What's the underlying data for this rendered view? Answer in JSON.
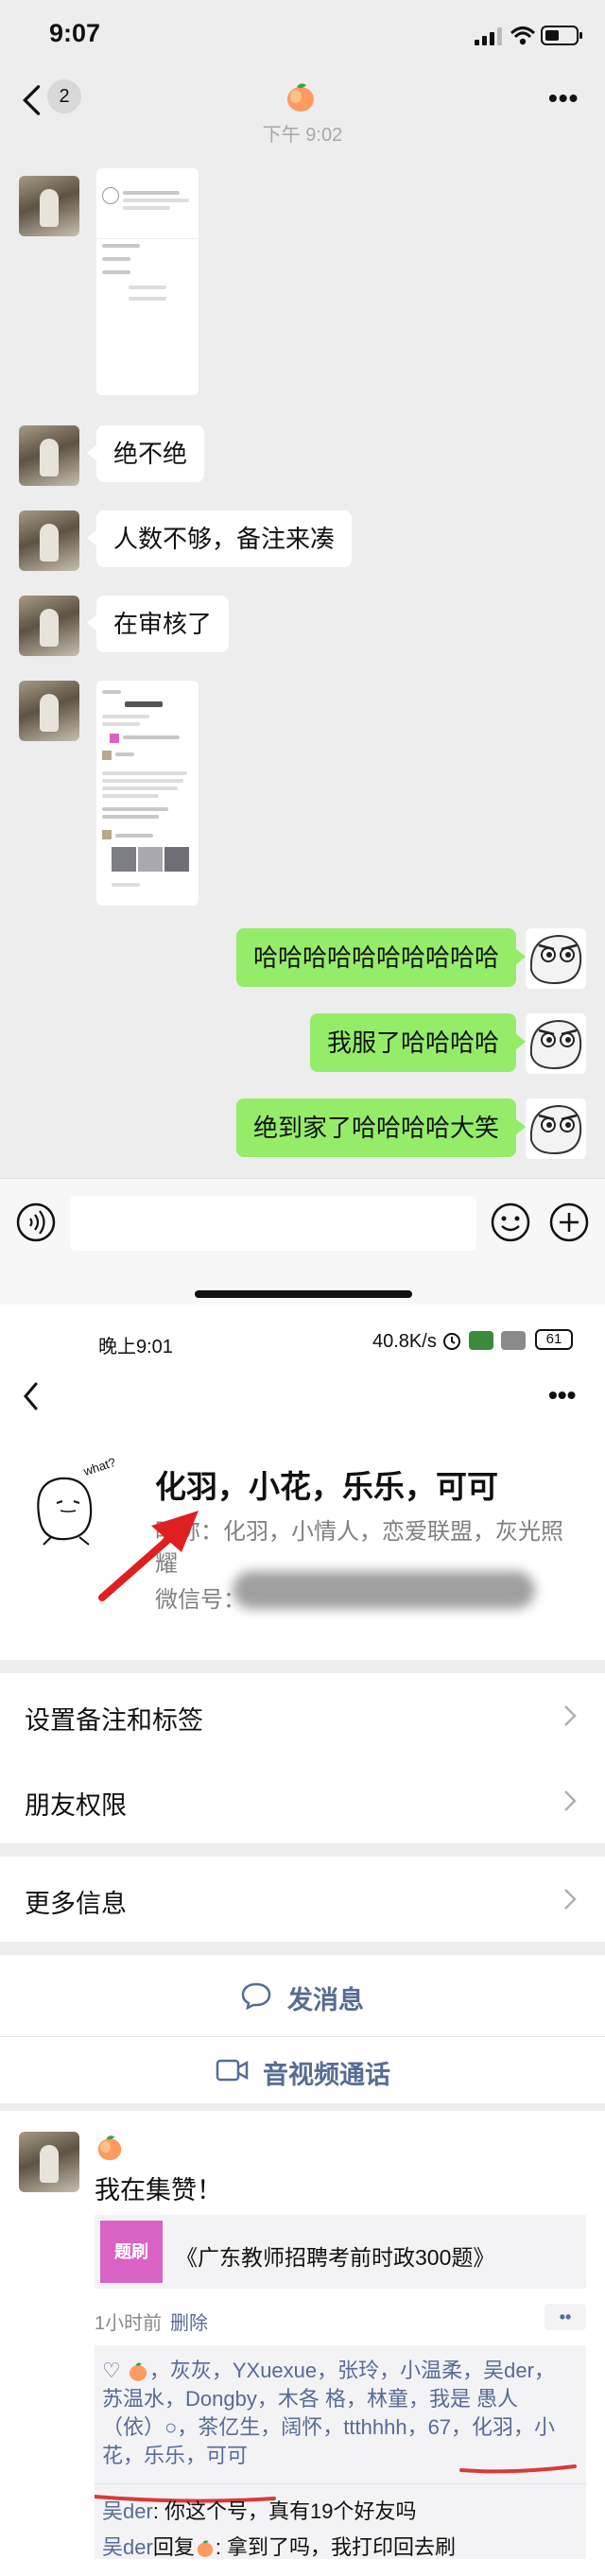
{
  "chat": {
    "status_time": "9:07",
    "unread_count": "2",
    "timestamp": "下午 9:02",
    "messages": [
      {
        "side": "left",
        "kind": "image"
      },
      {
        "side": "left",
        "kind": "text",
        "text": "绝不绝"
      },
      {
        "side": "left",
        "kind": "text",
        "text": "人数不够，备注来凑"
      },
      {
        "side": "left",
        "kind": "text",
        "text": "在审核了"
      },
      {
        "side": "left",
        "kind": "image"
      },
      {
        "side": "right",
        "kind": "text",
        "text": "哈哈哈哈哈哈哈哈哈哈"
      },
      {
        "side": "right",
        "kind": "text",
        "text": "我服了哈哈哈哈"
      },
      {
        "side": "right",
        "kind": "text",
        "text": "绝到家了哈哈哈哈大笑"
      }
    ]
  },
  "profile": {
    "status_time": "晚上9:01",
    "status_speed": "40.8K/s",
    "battery": "61",
    "avatar_text": "what?",
    "name": "化羽，小花，乐乐，可可",
    "nickname_line1": "昵称：化羽，小情人，恋爱联盟，灰光照",
    "nickname_line2": "耀",
    "wechat_id_label": "微信号：",
    "rows": [
      {
        "label": "设置备注和标签"
      },
      {
        "label": "朋友权限"
      },
      {
        "label": "更多信息"
      }
    ],
    "send_message": "发消息",
    "av_call": "音视频通话",
    "arrow_color": "#e02020"
  },
  "moment": {
    "post_text": "我在集赞！",
    "link_icon_text": "题刷",
    "link_title": "《广东教师招聘考前时政300题》",
    "time": "1小时前",
    "delete": "删除",
    "likes_line1": "，灰灰，YXuexue，张玲，小温柔，吴der，",
    "likes_line2": "苏温水，Dongby，木各  格，林童，我是 愚人",
    "likes_line3a": "（依）○，",
    "likes_line3b": "茶亿生，阔怀，ttthhhh，67，",
    "likes_line3c": "化羽，小",
    "likes_line4": "花，乐乐，可可",
    "comments": [
      {
        "author": "吴der",
        "text": ": 你这个号，真有19个好友吗"
      },
      {
        "author": "吴der",
        "text": "回复",
        "target_suffix": ": 拿到了吗，我打印回去刷"
      }
    ],
    "underline_color": "#d83a3a",
    "link_icon_color": "#d963c4"
  }
}
